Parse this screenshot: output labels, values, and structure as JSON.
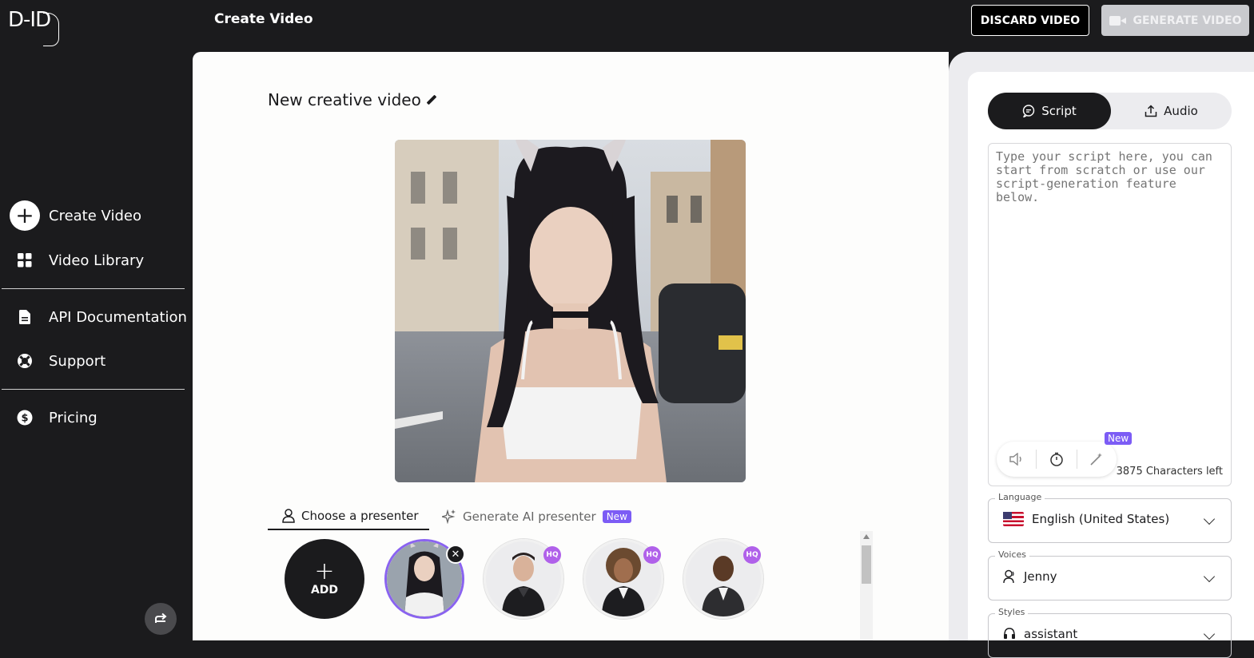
{
  "header": {
    "logo_text": "D-ID",
    "title": "Create Video",
    "discard_label": "DISCARD VIDEO",
    "generate_label": "GENERATE VIDEO"
  },
  "sidebar": {
    "items": [
      {
        "label": "Create Video",
        "icon": "plus-icon"
      },
      {
        "label": "Video Library",
        "icon": "grid-icon"
      },
      {
        "label": "API Documentation",
        "icon": "document-icon"
      },
      {
        "label": "Support",
        "icon": "lifebuoy-icon"
      },
      {
        "label": "Pricing",
        "icon": "dollar-icon"
      }
    ]
  },
  "main": {
    "video_name": "New creative video",
    "presenter_tabs": [
      {
        "label": "Choose a presenter",
        "active": true
      },
      {
        "label": "Generate AI presenter",
        "badge": "New",
        "active": false
      }
    ],
    "add_label": "ADD",
    "hq_label": "HQ"
  },
  "right": {
    "tabs": [
      {
        "label": "Script",
        "active": true
      },
      {
        "label": "Audio",
        "active": false
      }
    ],
    "script_placeholder": "Type your script here, you can start from scratch or use our script-generation feature below.",
    "new_tag": "New",
    "chars_left": "3875 Characters left",
    "language": {
      "label": "Language",
      "value": "English (United States)"
    },
    "voices": {
      "label": "Voices",
      "value": "Jenny"
    },
    "styles": {
      "label": "Styles",
      "value": "assistant"
    }
  },
  "colors": {
    "dark": "#1b1b1d",
    "accent": "#7c5cf5",
    "hq": "#b061ea"
  }
}
